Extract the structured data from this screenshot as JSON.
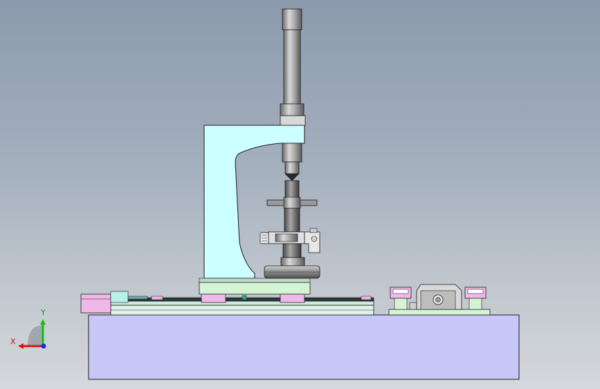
{
  "colors": {
    "background_top": "#8c9aad",
    "background_bottom": "#d5d8dc",
    "base_block": "#c8c8f8",
    "press_frame": "#ccffff",
    "slide_rail": "#d8f0e8",
    "pink_blocks": "#f0b8e8",
    "steel": "#9a9a9a",
    "outline": "#1a1a1a",
    "axis_x": "#e01010",
    "axis_y": "#10c010",
    "axis_z": "#1030e0"
  },
  "triad": {
    "x_label": "X",
    "y_label": "Y"
  }
}
